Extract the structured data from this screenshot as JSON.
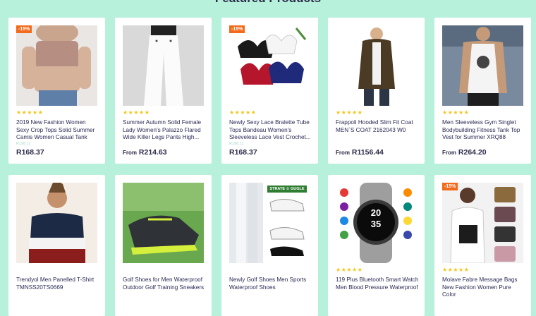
{
  "section": {
    "title": "Featured Products"
  },
  "colors": {
    "background": "#b7f1dc",
    "badge": "#f26a1b",
    "star": "#f5c518",
    "text": "#2a2a55"
  },
  "products": [
    {
      "badge": "-15%",
      "stars": "★★★★★",
      "rating": 5,
      "title": "2019 New Fashion Women Sexy Crop Tops Solid Summer Camis Women Casual Tank Tops Vest...",
      "old_price": "R198.11",
      "price": "R168.37",
      "price_prefix": "",
      "image": "crop-top-photo"
    },
    {
      "badge": "",
      "stars": "★★★★★",
      "rating": 5,
      "title": "Summer Autumn Solid Female Lady Women's Palazzo Flared Wide Killer Legs Pants High...",
      "old_price": "",
      "price": "R214.63",
      "price_prefix": "From",
      "image": "white-pants-photo"
    },
    {
      "badge": "-15%",
      "stars": "★★★★★",
      "rating": 5,
      "title": "Newly Sexy Lace Bralette Tube Tops Bandeau Women's Sleeveless Lace Vest Crochet...",
      "old_price": "R198.11",
      "price": "R168.37",
      "price_prefix": "",
      "image": "lace-bralette-photo"
    },
    {
      "badge": "",
      "stars": "★★★★★",
      "rating": 5,
      "title": "Frappoli Hooded Slim Fit Coat MEN`S COAT 2162043 W0",
      "old_price": "",
      "price": "R1156.44",
      "price_prefix": "From",
      "image": "hooded-coat-photo"
    },
    {
      "badge": "",
      "stars": "★★★★★",
      "rating": 5,
      "title": "Men Sleeveless Gym Singlet Bodybuilding Fitness Tank Top Vest for Summer XRQ88",
      "old_price": "",
      "price": "R264.20",
      "price_prefix": "From",
      "image": "gym-singlet-photo"
    },
    {
      "badge": "",
      "stars": "",
      "rating": 0,
      "title": "Trendyol Men Panelled T-Shirt TMNSS20TS0669",
      "old_price": "",
      "price": "",
      "price_prefix": "",
      "image": "panelled-tshirt-photo"
    },
    {
      "badge": "",
      "stars": "",
      "rating": 0,
      "title": "Golf Shoes for Men Waterproof Outdoor Golf Training Sneakers",
      "old_price": "",
      "price": "",
      "price_prefix": "",
      "image": "golf-shoes-photo"
    },
    {
      "badge": "",
      "stars": "",
      "rating": 0,
      "title": "Newly Golf Shoes Men Sports Waterproof Shoes",
      "old_price": "",
      "price": "",
      "price_prefix": "",
      "image": "golf-shoes-collage-photo",
      "image_text": "STRATE ☆ GUGLE"
    },
    {
      "badge": "",
      "stars": "★★★★★",
      "rating": 4.5,
      "title": "119 Plus Bluetooth Smart Watch Men Blood Pressure Waterproof",
      "old_price": "",
      "price": "",
      "price_prefix": "",
      "image": "smart-watch-photo",
      "watch_time_top": "20",
      "watch_time_bottom": "35"
    },
    {
      "badge": "-15%",
      "stars": "★★★★★",
      "rating": 4,
      "title": "Molave Fabre Message Bags New Fashion Women Pure Color",
      "old_price": "",
      "price": "",
      "price_prefix": "",
      "image": "message-bags-photo"
    }
  ]
}
